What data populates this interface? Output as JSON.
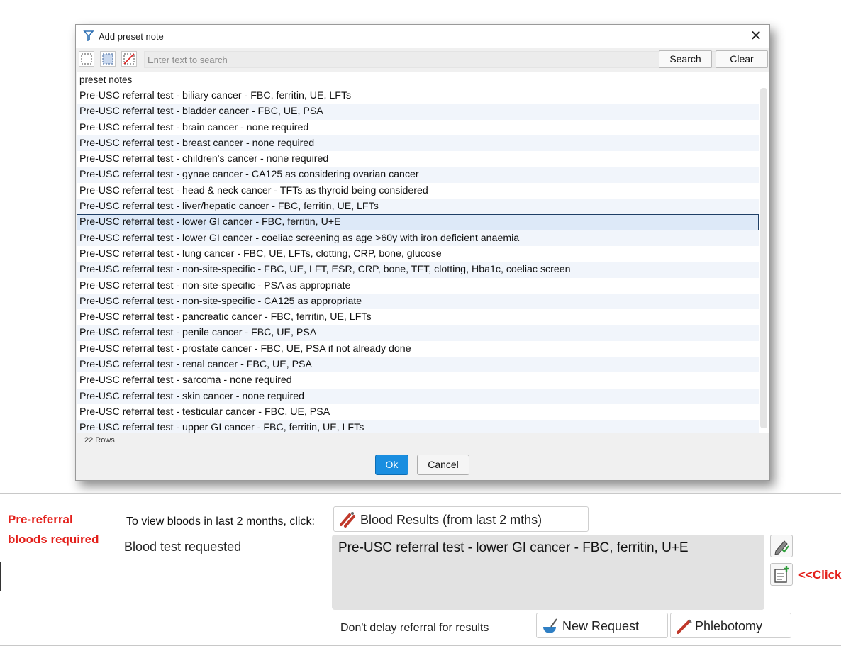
{
  "dialog": {
    "title": "Add preset note",
    "close_label": "✕",
    "search": {
      "placeholder": "Enter text to search",
      "value": "",
      "search_label": "Search",
      "clear_label": "Clear"
    },
    "list": {
      "header": "preset notes",
      "selected_index": 8,
      "rows": [
        "Pre-USC referral test - biliary cancer - FBC, ferritin, UE, LFTs",
        "Pre-USC referral test - bladder cancer - FBC, UE, PSA",
        "Pre-USC referral test - brain cancer - none required",
        "Pre-USC referral test - breast cancer - none required",
        "Pre-USC referral test - children's cancer - none required",
        "Pre-USC referral test - gynae cancer - CA125 as considering ovarian cancer",
        "Pre-USC referral test - head & neck cancer - TFTs as thyroid being considered",
        "Pre-USC referral test - liver/hepatic cancer - FBC, ferritin, UE, LFTs",
        "Pre-USC referral test - lower GI cancer - FBC, ferritin, U+E",
        "Pre-USC referral test - lower GI cancer - coeliac screening as age >60y with iron deficient anaemia",
        "Pre-USC referral test - lung cancer - FBC, UE, LFTs, clotting, CRP, bone, glucose",
        "Pre-USC referral test - non-site-specific - FBC, UE, LFT, ESR, CRP, bone, TFT, clotting, Hba1c, coeliac screen",
        "Pre-USC referral test - non-site-specific - PSA as appropriate",
        "Pre-USC referral test - non-site-specific - CA125 as appropriate",
        "Pre-USC referral test - pancreatic cancer - FBC, ferritin, UE, LFTs",
        "Pre-USC referral test - penile cancer - FBC, UE, PSA",
        "Pre-USC referral test - prostate cancer - FBC, UE, PSA if not already done",
        "Pre-USC referral test - renal cancer - FBC, UE, PSA",
        "Pre-USC referral test - sarcoma - none required",
        "Pre-USC referral test - skin cancer - none required",
        "Pre-USC referral test - testicular cancer - FBC, UE, PSA",
        "Pre-USC referral test - upper GI cancer - FBC, ferritin, UE, LFTs"
      ]
    },
    "row_count": "22 Rows",
    "ok_label": "Ok",
    "cancel_label": "Cancel"
  },
  "form": {
    "warning_line1": "Pre-referral",
    "warning_line2": "bloods required",
    "view_label": "To view bloods in last 2 months, click:",
    "results_button": "Blood Results (from last 2 mths)",
    "blood_label": "Blood test requested",
    "note_value": "Pre-USC referral test - lower GI cancer - FBC, ferritin, U+E",
    "click_hint": "<<Click",
    "delay_label": "Don't delay referral for results",
    "new_request_button": "New Request",
    "phlebotomy_button": "Phlebotomy"
  },
  "colors": {
    "accent": "#1a8ee0",
    "warning": "#e3201b",
    "selection": "#dde9f8"
  }
}
